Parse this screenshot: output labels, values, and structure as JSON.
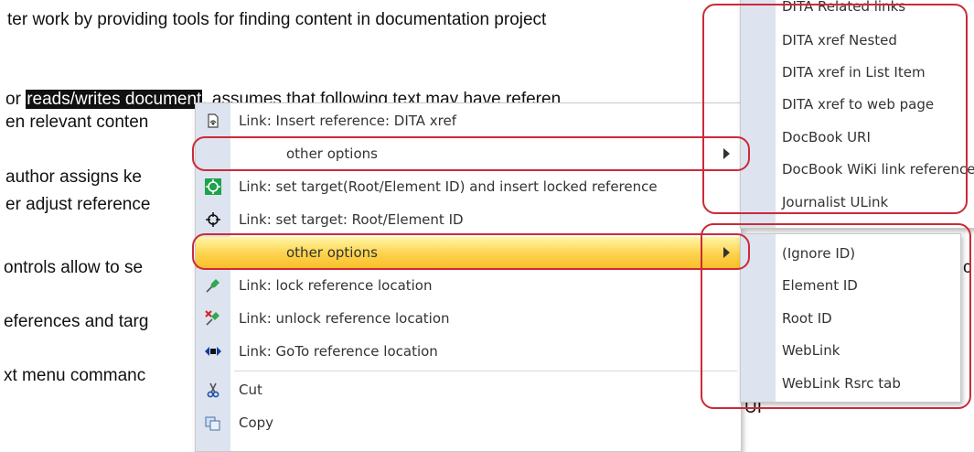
{
  "document": {
    "lines": [
      {
        "text": "ter work by providing tools for finding content in documentation project"
      },
      {
        "prefix": "or ",
        "highlight": "reads/writes document",
        "rest": ", assumes that following text may have referen"
      },
      {
        "text": "en relevant conten"
      },
      {
        "text": " author assigns ke"
      },
      {
        "text": "er adjust reference"
      },
      {
        "text": "ontrols allow to se"
      },
      {
        "text": "eferences and targ"
      },
      {
        "text": "xt menu commanc"
      },
      {
        "text": "c"
      },
      {
        "text": "UI"
      }
    ]
  },
  "context_menu": {
    "items": [
      {
        "label": "Link: Insert reference: DITA xref",
        "icon": "insert-reference-icon"
      },
      {
        "label": "other options",
        "icon": "",
        "submenu": true
      },
      {
        "label": "Link: set target(Root/Element ID) and insert locked reference",
        "icon": "target-locked-reference-icon"
      },
      {
        "label": "Link: set target: Root/Element ID",
        "icon": "crosshair-target-icon"
      },
      {
        "label": "other options",
        "icon": "",
        "submenu": true,
        "highlighted": true
      },
      {
        "label": "Link: lock reference location",
        "icon": "green-pin-icon"
      },
      {
        "label": "Link: unlock reference location",
        "icon": "unpin-icon"
      },
      {
        "label": "Link: GoTo reference location",
        "icon": "goto-location-icon"
      },
      {
        "label": "Cut",
        "icon": "scissors-icon"
      },
      {
        "label": "Copy",
        "icon": "copy-icon"
      }
    ]
  },
  "submenu_reference_types": {
    "items": [
      {
        "label": "DITA Related links"
      },
      {
        "label": "DITA xref Nested"
      },
      {
        "label": "DITA xref in List Item"
      },
      {
        "label": "DITA xref to web page"
      },
      {
        "label": "DocBook URI"
      },
      {
        "label": "DocBook WiKi link reference"
      },
      {
        "label": "Journalist ULink"
      }
    ]
  },
  "submenu_target_types": {
    "items": [
      {
        "label": "(Ignore ID)"
      },
      {
        "label": "Element ID"
      },
      {
        "label": "Root ID"
      },
      {
        "label": "WebLink"
      },
      {
        "label": "WebLink Rsrc tab"
      }
    ]
  },
  "colors": {
    "annotation": "#cc2a3a",
    "menu_gutter": "#dde4ef",
    "highlight_top": "#fff6a6",
    "highlight_bottom": "#f9bf2b"
  }
}
